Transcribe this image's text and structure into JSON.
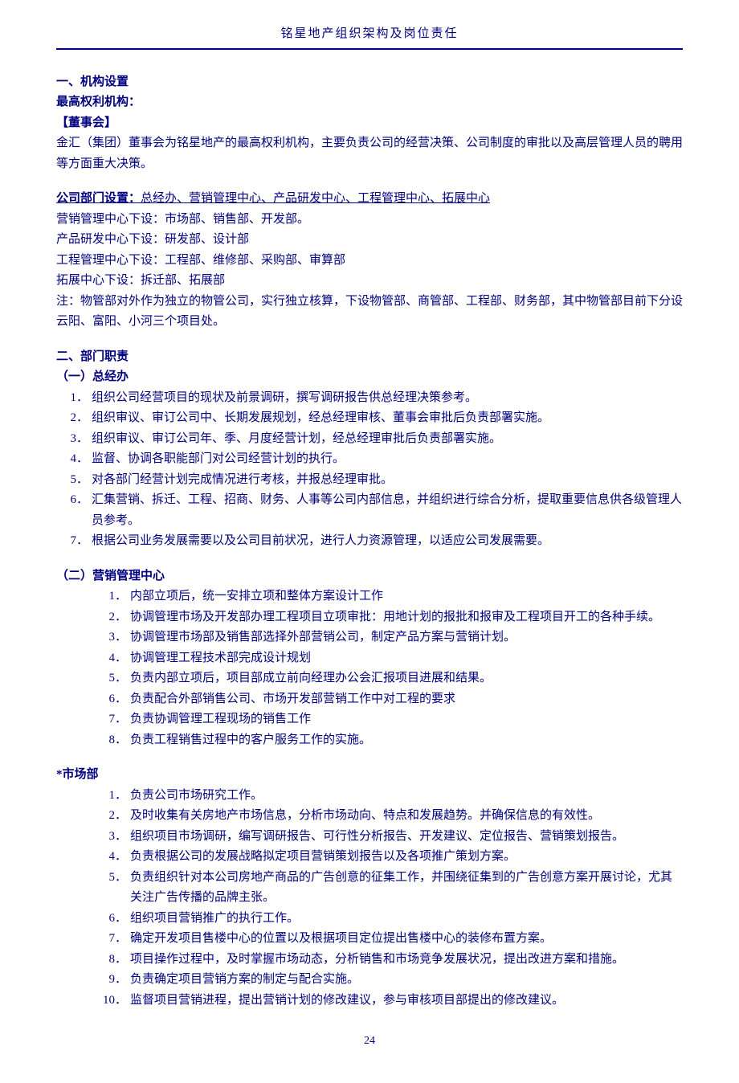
{
  "header": "铭星地产组织架构及岗位责任",
  "h1_1": "一、机构设置",
  "top_auth": "最高权利机构：",
  "board": "【董事会】",
  "board_desc": "金汇（集团）董事会为铭星地产的最高权利机构，主要负责公司的经营决策、公司制度的审批以及高层管理人员的聘用等方面重大决策。",
  "dept_label": "公司部门设置：",
  "dept_list": "总经办、营销管理中心、产品研发中心、工程管理中心、拓展中心",
  "sub1": "营销管理中心下设：市场部、销售部、开发部。",
  "sub2": "产品研发中心下设：研发部、设计部",
  "sub3": "工程管理中心下设：工程部、维修部、采购部、审算部",
  "sub4": "拓展中心下设：拆迁部、拓展部",
  "note": "注：物管部对外作为独立的物管公司，实行独立核算，下设物管部、商管部、工程部、财务部，其中物管部目前下分设云阳、富阳、小河三个项目处。",
  "h1_2": "二、部门职责",
  "s1_title": "（一）总经办",
  "s1_items": [
    "组织公司经营项目的现状及前景调研，撰写调研报告供总经理决策参考。",
    "组织审议、审订公司中、长期发展规划，经总经理审核、董事会审批后负责部署实施。",
    "组织审议、审订公司年、季、月度经营计划，经总经理审批后负责部署实施。",
    "监督、协调各职能部门对公司经营计划的执行。",
    "对各部门经营计划完成情况进行考核，并报总经理审批。",
    "汇集营销、拆迁、工程、招商、财务、人事等公司内部信息，并组织进行综合分析，提取重要信息供各级管理人员参考。",
    "根据公司业务发展需要以及公司目前状况，进行人力资源管理，以适应公司发展需要。"
  ],
  "s2_title": "（二）营销管理中心",
  "s2_items": [
    "内部立项后，统一安排立项和整体方案设计工作",
    "协调管理市场及开发部办理工程项目立项审批：用地计划的报批和报审及工程项目开工的各种手续。",
    "协调管理市场部及销售部选择外部营销公司，制定产品方案与营销计划。",
    "协调管理工程技术部完成设计规划",
    "负责内部立项后，项目部成立前向经理办公会汇报项目进展和结果。",
    "负责配合外部销售公司、市场开发部营销工作中对工程的要求",
    "负责协调管理工程现场的销售工作",
    "负责工程销售过程中的客户服务工作的实施。"
  ],
  "s3_title": "*市场部",
  "s3_items": [
    "负责公司市场研究工作。",
    "及时收集有关房地产市场信息，分析市场动向、特点和发展趋势。并确保信息的有效性。",
    "组织项目市场调研，编写调研报告、可行性分析报告、开发建议、定位报告、营销策划报告。",
    "负责根据公司的发展战略拟定项目营销策划报告以及各项推广策划方案。",
    "负责组织针对本公司房地产商品的广告创意的征集工作，并围绕征集到的广告创意方案开展讨论，尤其关注广告传播的品牌主张。",
    "组织项目营销推广的执行工作。",
    "确定开发项目售楼中心的位置以及根据项目定位提出售楼中心的装修布置方案。",
    "项目操作过程中，及时掌握市场动态，分析销售和市场竞争发展状况，提出改进方案和措施。",
    "负责确定项目营销方案的制定与配合实施。",
    "监督项目营销进程，提出营销计划的修改建议，参与审核项目部提出的修改建议。"
  ],
  "page_num": "24"
}
